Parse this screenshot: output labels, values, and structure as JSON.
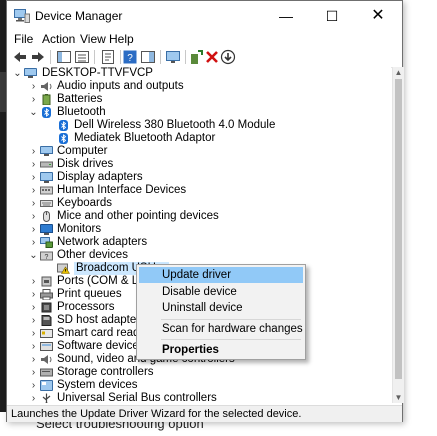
{
  "window": {
    "title": "Device Manager",
    "controls": {
      "minimize": "—",
      "maximize": "☐",
      "close": "✕"
    }
  },
  "menu": [
    "File",
    "Action",
    "View",
    "Help"
  ],
  "tree": {
    "root": "DESKTOP-TTVFVCP",
    "items": [
      "Audio inputs and outputs",
      "Batteries",
      "Bluetooth",
      "Dell Wireless 380 Bluetooth 4.0 Module",
      "Mediatek Bluetooth Adaptor",
      "Computer",
      "Disk drives",
      "Display adapters",
      "Human Interface Devices",
      "Keyboards",
      "Mice and other pointing devices",
      "Monitors",
      "Network adapters",
      "Other devices",
      "Broadcom USH w",
      "Ports (COM & LPT)",
      "Print queues",
      "Processors",
      "SD host adapters",
      "Smart card readers",
      "Software devices",
      "Sound, video and game controllers",
      "Storage controllers",
      "System devices",
      "Universal Serial Bus controllers"
    ]
  },
  "context_menu": {
    "items": [
      "Update driver",
      "Disable device",
      "Uninstall device",
      "Scan for hardware changes",
      "Properties"
    ]
  },
  "status_bar": "Launches the Update Driver Wizard for the selected device.",
  "background_text": "Select troubleshooting option",
  "colors": {
    "selection": "#cde8ff",
    "menu_highlight": "#91c9f7",
    "bluetooth_icon": "#1a6fd6",
    "warning_icon": "#e8c000"
  }
}
